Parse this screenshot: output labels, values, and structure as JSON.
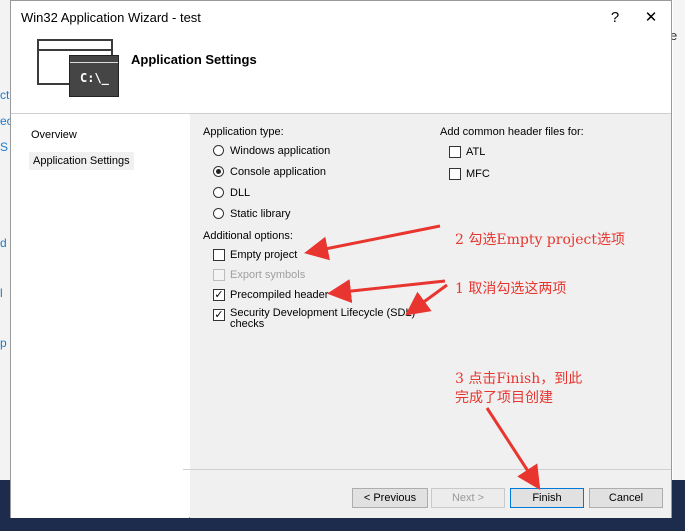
{
  "window": {
    "title": "Win32 Application Wizard - test",
    "help_label": "?",
    "close_label": "✕"
  },
  "header": {
    "title": "Application Settings",
    "icon_text": "C:\\_"
  },
  "background": {
    "right_glyph": "e",
    "left_glyphs": [
      "ct",
      "ec",
      "S",
      "d",
      "l",
      "p"
    ]
  },
  "sidebar": {
    "items": [
      {
        "label": "Overview",
        "selected": false
      },
      {
        "label": "Application Settings",
        "selected": true
      }
    ]
  },
  "app_type": {
    "label": "Application type:",
    "options": [
      {
        "label": "Windows application",
        "selected": false
      },
      {
        "label": "Console application",
        "selected": true
      },
      {
        "label": "DLL",
        "selected": false
      },
      {
        "label": "Static library",
        "selected": false
      }
    ]
  },
  "headers": {
    "label": "Add common header files for:",
    "options": [
      {
        "label": "ATL",
        "checked": false
      },
      {
        "label": "MFC",
        "checked": false
      }
    ]
  },
  "additional": {
    "label": "Additional options:",
    "options": [
      {
        "label": "Empty project",
        "checked": false,
        "enabled": true
      },
      {
        "label": "Export symbols",
        "checked": false,
        "enabled": false
      },
      {
        "label": "Precompiled header",
        "checked": true,
        "enabled": true
      },
      {
        "label": "Security Development Lifecycle (SDL)",
        "label2": "checks",
        "checked": true,
        "enabled": true
      }
    ]
  },
  "buttons": {
    "previous": "< Previous",
    "next": "Next >",
    "finish": "Finish",
    "cancel": "Cancel"
  },
  "annotations": {
    "a2": "2 勾选Empty project选项",
    "a1": "1 取消勾选这两项",
    "a3_line1": "3 点击Finish，到此",
    "a3_line2": "完成了项目创建",
    "color": "#e8352f"
  }
}
